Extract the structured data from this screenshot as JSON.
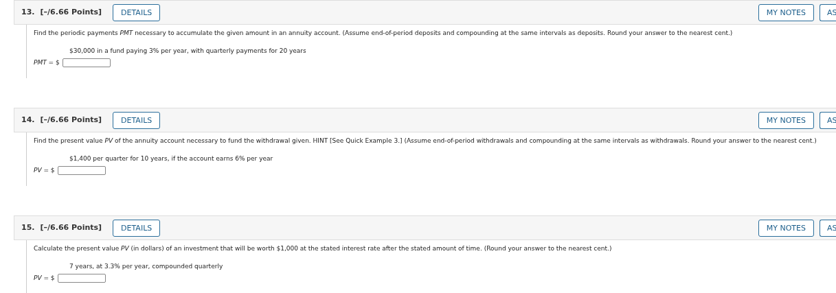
{
  "questions": [
    {
      "number": "13.",
      "points": "[–/6.66 Points]",
      "details_button": "DETAILS",
      "notes_button": "MY NOTES",
      "cut_button": "AS",
      "prompt": "Find the periodic payments *PMT* necessary to accumulate the given amount in an annuity account. (Assume end-of-period deposits and compounding at the same intervals as deposits. Round your answer to the nearest cent.)",
      "given": "$30,000 in a fund paying 3% per year, with quarterly payments for 20 years",
      "answer_label": "*PMT* = $"
    },
    {
      "number": "14.",
      "points": "[–/6.66 Points]",
      "details_button": "DETAILS",
      "notes_button": "MY NOTES",
      "cut_button": "AS",
      "prompt": "Find the present value *PV* of the annuity account necessary to fund the withdrawal given. HINT [See Quick Example 3.] (Assume end-of-period withdrawals and compounding at the same intervals as withdrawals. Round your answer to the nearest cent.)",
      "given": "$1,400 per quarter for 10 years, if the account earns 6% per year",
      "answer_label": "*PV* = $"
    },
    {
      "number": "15.",
      "points": "[–/6.66 Points]",
      "details_button": "DETAILS",
      "notes_button": "MY NOTES",
      "cut_button": "AS",
      "prompt": "Calculate the present value *PV* (in dollars) of an investment that will be worth $1,000 at the stated interest rate after the stated amount of time. (Round your answer to the nearest cent.)",
      "given": "7 years, at 3.3% per year, compounded quarterly",
      "answer_label": "*PV* = $"
    }
  ]
}
